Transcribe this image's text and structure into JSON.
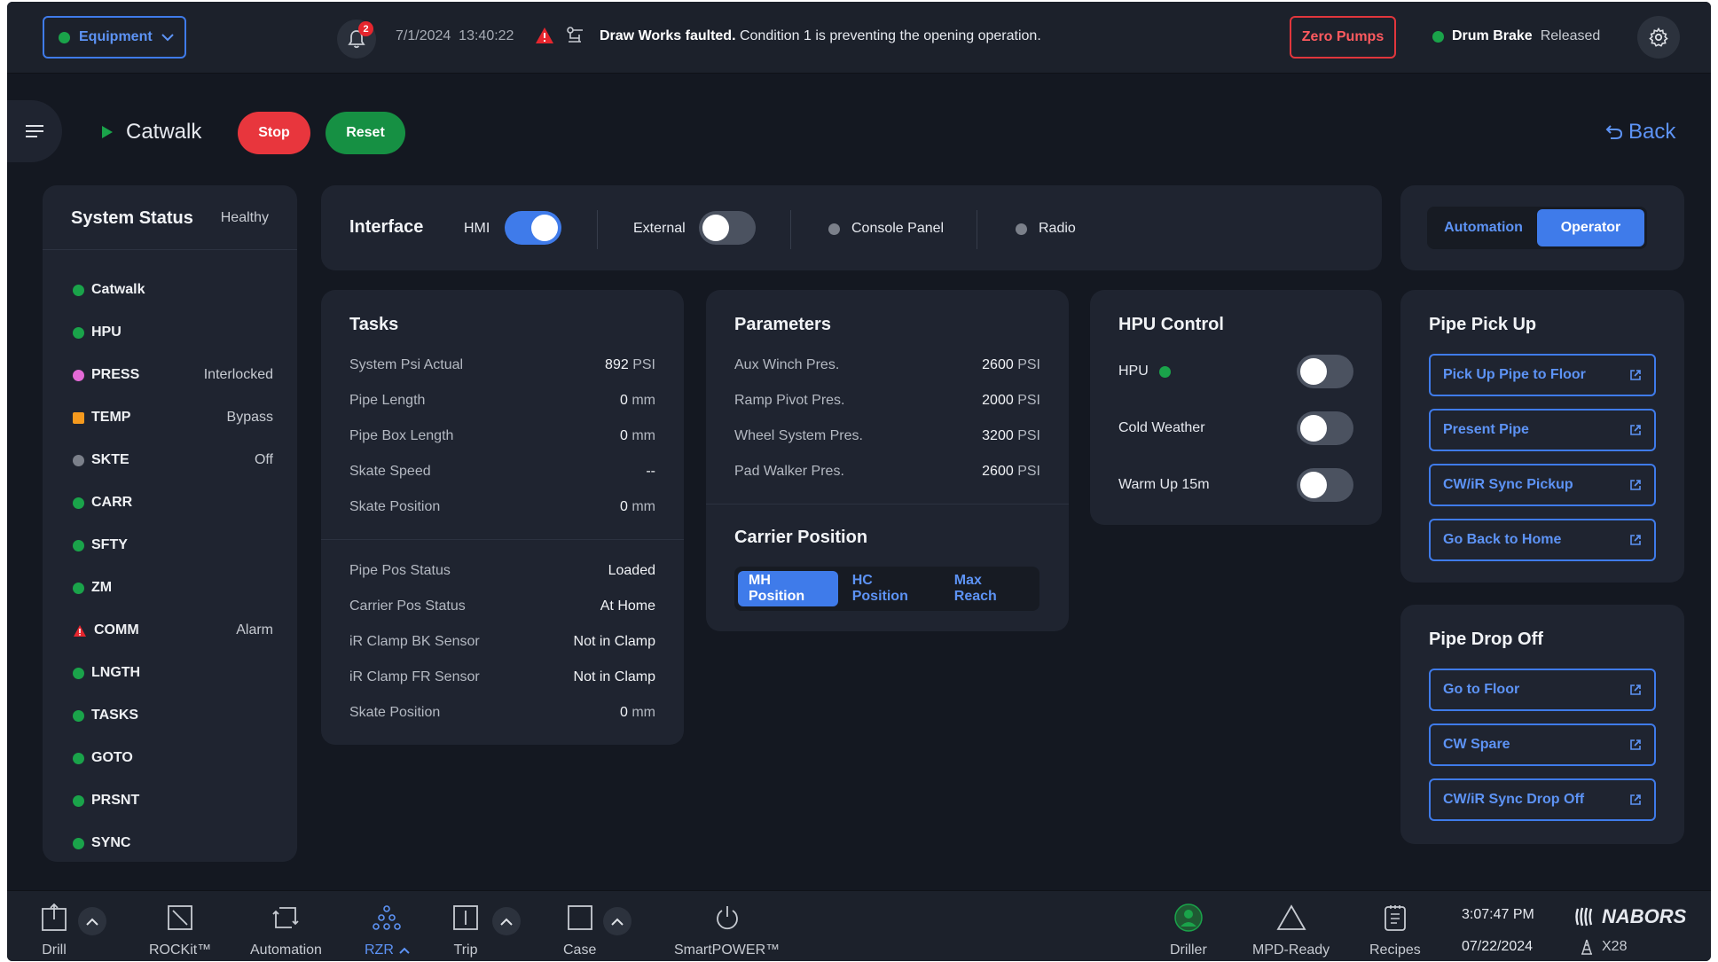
{
  "topbar": {
    "equipment_label": "Equipment",
    "notification_count": "2",
    "date": "7/1/2024",
    "time": "13:40:22",
    "fault_title": "Draw Works faulted.",
    "fault_message": "Condition 1 is preventing the opening operation.",
    "zero_pumps_label": "Zero Pumps",
    "drum_brake_label": "Drum Brake",
    "drum_brake_status": "Released"
  },
  "header": {
    "page_title": "Catwalk",
    "stop_label": "Stop",
    "reset_label": "Reset",
    "back_label": "Back"
  },
  "system_status": {
    "title": "System Status",
    "health": "Healthy",
    "items": [
      {
        "name": "Catwalk",
        "indicator": "green",
        "status": ""
      },
      {
        "name": "HPU",
        "indicator": "green",
        "status": ""
      },
      {
        "name": "PRESS",
        "indicator": "pink",
        "status": "Interlocked"
      },
      {
        "name": "TEMP",
        "indicator": "orange-square",
        "status": "Bypass"
      },
      {
        "name": "SKTE",
        "indicator": "gray",
        "status": "Off"
      },
      {
        "name": "CARR",
        "indicator": "green",
        "status": ""
      },
      {
        "name": "SFTY",
        "indicator": "green",
        "status": ""
      },
      {
        "name": "ZM",
        "indicator": "green",
        "status": ""
      },
      {
        "name": "COMM",
        "indicator": "alarm-triangle",
        "status": "Alarm"
      },
      {
        "name": "LNGTH",
        "indicator": "green",
        "status": ""
      },
      {
        "name": "TASKS",
        "indicator": "green",
        "status": ""
      },
      {
        "name": "GOTO",
        "indicator": "green",
        "status": ""
      },
      {
        "name": "PRSNT",
        "indicator": "green",
        "status": ""
      },
      {
        "name": "SYNC",
        "indicator": "green",
        "status": ""
      }
    ]
  },
  "interface": {
    "title": "Interface",
    "hmi_label": "HMI",
    "hmi_on": true,
    "external_label": "External",
    "external_on": false,
    "console_panel_label": "Console Panel",
    "radio_label": "Radio"
  },
  "mode": {
    "automation_label": "Automation",
    "operator_label": "Operator",
    "selected": "Operator"
  },
  "tasks": {
    "title": "Tasks",
    "rows": [
      {
        "label": "System Psi Actual",
        "value": "892",
        "unit": "PSI"
      },
      {
        "label": "Pipe Length",
        "value": "0",
        "unit": "mm"
      },
      {
        "label": "Pipe Box Length",
        "value": "0",
        "unit": "mm"
      },
      {
        "label": "Skate Speed",
        "value": "--",
        "unit": ""
      },
      {
        "label": "Skate Position",
        "value": "0",
        "unit": "mm"
      }
    ],
    "status_rows": [
      {
        "label": "Pipe Pos Status",
        "value": "Loaded"
      },
      {
        "label": "Carrier Pos Status",
        "value": "At Home"
      },
      {
        "label": "iR Clamp BK Sensor",
        "value": "Not in Clamp"
      },
      {
        "label": "iR Clamp FR Sensor",
        "value": "Not in Clamp"
      },
      {
        "label": "Skate Position",
        "value": "0",
        "unit": "mm"
      }
    ]
  },
  "parameters": {
    "title": "Parameters",
    "rows": [
      {
        "label": "Aux Winch Pres.",
        "value": "2600",
        "unit": "PSI"
      },
      {
        "label": "Ramp Pivot Pres.",
        "value": "2000",
        "unit": "PSI"
      },
      {
        "label": "Wheel System Pres.",
        "value": "3200",
        "unit": "PSI"
      },
      {
        "label": "Pad Walker Pres.",
        "value": "2600",
        "unit": "PSI"
      }
    ],
    "carrier_title": "Carrier Position",
    "carrier_options": [
      "MH Position",
      "HC Position",
      "Max Reach"
    ],
    "carrier_selected": "MH Position"
  },
  "hpu_control": {
    "title": "HPU Control",
    "rows": [
      {
        "label": "HPU",
        "on": false
      },
      {
        "label": "Cold Weather",
        "on": false
      },
      {
        "label": "Warm Up 15m",
        "on": false
      }
    ]
  },
  "pipe_pick_up": {
    "title": "Pipe Pick Up",
    "buttons": [
      "Pick Up Pipe to Floor",
      "Present Pipe",
      "CW/iR Sync Pickup",
      "Go Back to Home"
    ]
  },
  "pipe_drop_off": {
    "title": "Pipe Drop Off",
    "buttons": [
      "Go to Floor",
      "CW Spare",
      "CW/iR Sync Drop Off"
    ]
  },
  "bottombar": {
    "nav": [
      {
        "label": "Drill"
      },
      {
        "label": "ROCKit™"
      },
      {
        "label": "Automation"
      },
      {
        "label": "RZR",
        "active": true
      },
      {
        "label": "Trip"
      },
      {
        "label": "Case"
      },
      {
        "label": "SmartPOWER™"
      },
      {
        "label": "Driller"
      },
      {
        "label": "MPD-Ready"
      },
      {
        "label": "Recipes"
      }
    ],
    "clock": "3:07:47 PM",
    "date": "07/22/2024",
    "brand": "NABORS",
    "rig": "X28"
  },
  "colors": {
    "accent": "#3f7bea",
    "ok": "#1aa34a",
    "danger": "#e8363d",
    "background": "#141821",
    "panel": "#1f2430"
  }
}
